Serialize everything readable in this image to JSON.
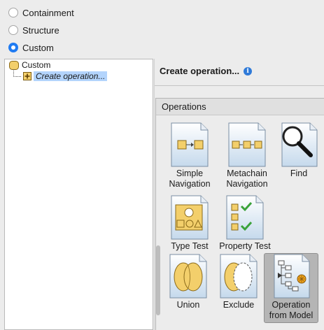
{
  "mode_options": [
    {
      "label": "Containment",
      "checked": false
    },
    {
      "label": "Structure",
      "checked": false
    },
    {
      "label": "Custom",
      "checked": true
    }
  ],
  "tree": {
    "root_label": "Custom",
    "child_label": "Create operation..."
  },
  "right_panel": {
    "title": "Create operation...",
    "info_icon": "info-icon"
  },
  "operations": {
    "header": "Operations",
    "items": [
      {
        "line1": "Simple",
        "line2": "Navigation",
        "icon": "simple-navigation-icon",
        "selected": false
      },
      {
        "line1": "Metachain",
        "line2": "Navigation",
        "icon": "metachain-navigation-icon",
        "selected": false
      },
      {
        "line1": "Find",
        "line2": "",
        "icon": "find-icon",
        "selected": false
      },
      {
        "line1": "Type Test",
        "line2": "",
        "icon": "type-test-icon",
        "selected": false
      },
      {
        "line1": "Property Test",
        "line2": "",
        "icon": "property-test-icon",
        "selected": false
      },
      {
        "line1": "Union",
        "line2": "",
        "icon": "union-icon",
        "selected": false
      },
      {
        "line1": "Exclude",
        "line2": "",
        "icon": "exclude-icon",
        "selected": false
      },
      {
        "line1": "Operation",
        "line2": "from Model",
        "icon": "operation-from-model-icon",
        "selected": true
      }
    ]
  },
  "colors": {
    "accent": "#1f7bf2",
    "selection": "#b3d4fc",
    "icon_yellow": "#f3cf6b",
    "icon_check": "#3aa23a"
  }
}
